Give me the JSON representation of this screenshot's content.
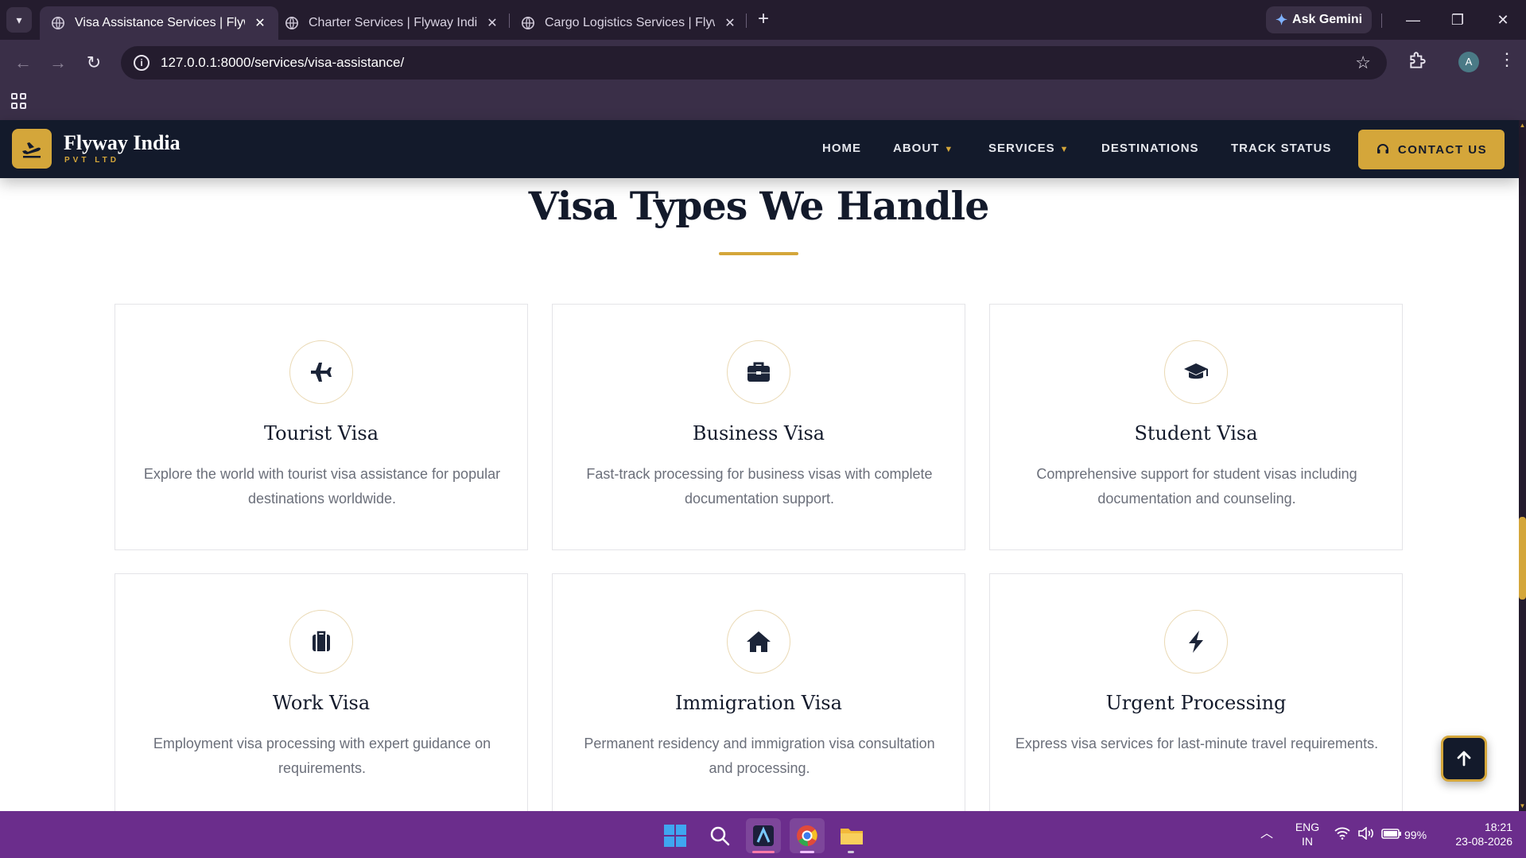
{
  "browser": {
    "tabs": [
      {
        "title": "Visa Assistance Services | Flyway India Pvt Ltd",
        "active": true
      },
      {
        "title": "Charter Services | Flyway India Pvt Ltd",
        "active": false
      },
      {
        "title": "Cargo Logistics Services | Flyway India Pvt Ltd",
        "active": false
      }
    ],
    "ask_gemini": "Ask Gemini",
    "url": "127.0.0.1:8000/services/visa-assistance/",
    "profile_initial": "A"
  },
  "site": {
    "brand_name": "Flyway India",
    "brand_sub": "PVT LTD",
    "nav": {
      "home": "HOME",
      "about": "ABOUT",
      "services": "SERVICES",
      "destinations": "DESTINATIONS",
      "track_status": "TRACK STATUS",
      "contact": "CONTACT US"
    },
    "accent_color": "#d4a63a",
    "dark_color": "#131a2b"
  },
  "section": {
    "title": "Visa Types We Handle",
    "cards": [
      {
        "icon": "plane-icon",
        "title": "Tourist Visa",
        "text": "Explore the world with tourist visa assistance for popular destinations worldwide."
      },
      {
        "icon": "briefcase-icon",
        "title": "Business Visa",
        "text": "Fast-track processing for business visas with complete documentation support."
      },
      {
        "icon": "graduation-cap-icon",
        "title": "Student Visa",
        "text": "Comprehensive support for student visas including documentation and counseling."
      },
      {
        "icon": "suitcase-icon",
        "title": "Work Visa",
        "text": "Employment visa processing with expert guidance on requirements."
      },
      {
        "icon": "home-icon",
        "title": "Immigration Visa",
        "text": "Permanent residency and immigration visa consultation and processing."
      },
      {
        "icon": "bolt-icon",
        "title": "Urgent Processing",
        "text": "Express visa services for last-minute travel requirements."
      }
    ]
  },
  "taskbar": {
    "lang_top": "ENG",
    "lang_bottom": "IN",
    "battery": "99%",
    "time": "18:21",
    "date": "23-08-2026"
  }
}
